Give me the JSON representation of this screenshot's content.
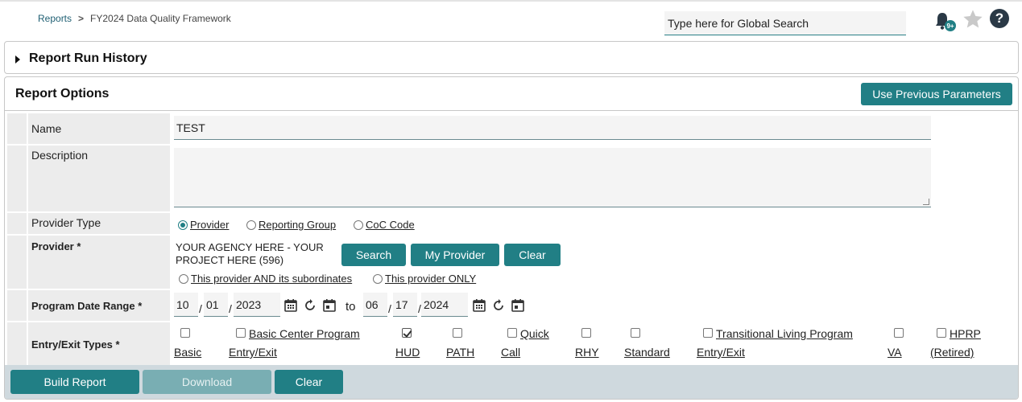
{
  "breadcrumb": {
    "root": "Reports",
    "separator": ">",
    "current": "FY2024 Data Quality Framework"
  },
  "global_search": {
    "placeholder": "Type here for Global Search"
  },
  "notifications": {
    "badge": "9+"
  },
  "help": {
    "glyph": "?"
  },
  "run_history": {
    "title": "Report Run History"
  },
  "options": {
    "title": "Report Options",
    "use_previous_label": "Use Previous Parameters",
    "name": {
      "label": "Name",
      "value": "TEST"
    },
    "description": {
      "label": "Description",
      "value": ""
    },
    "provider_type": {
      "label": "Provider Type",
      "options": [
        "Provider",
        "Reporting Group",
        "CoC Code"
      ],
      "selected": "Provider"
    },
    "provider": {
      "label": "Provider *",
      "value_line1": "YOUR AGENCY HERE - YOUR",
      "value_line2": "PROJECT HERE (596)",
      "search_label": "Search",
      "my_provider_label": "My Provider",
      "clear_label": "Clear",
      "scope_options": [
        "This provider AND its subordinates",
        "This provider ONLY"
      ]
    },
    "date_range": {
      "label": "Program Date Range *",
      "start": {
        "month": "10",
        "day": "01",
        "year": "2023"
      },
      "to": "to",
      "end": {
        "month": "06",
        "day": "17",
        "year": "2024"
      },
      "separator": "/"
    },
    "entry_exit": {
      "label": "Entry/Exit Types *",
      "types": [
        {
          "line1": "",
          "line2": "Basic",
          "checked": false
        },
        {
          "line1": "Basic Center Program",
          "line2": "Entry/Exit",
          "checked": false
        },
        {
          "line1": "",
          "line2": "HUD",
          "checked": true
        },
        {
          "line1": "",
          "line2": "PATH",
          "checked": false
        },
        {
          "line1": "Quick",
          "line2": "Call",
          "checked": false
        },
        {
          "line1": "",
          "line2": "RHY",
          "checked": false
        },
        {
          "line1": "",
          "line2": "Standard",
          "checked": false
        },
        {
          "line1": "Transitional Living Program",
          "line2": "Entry/Exit",
          "checked": false
        },
        {
          "line1": "",
          "line2": "VA",
          "checked": false
        },
        {
          "line1": "HPRP",
          "line2": "(Retired)",
          "checked": false
        }
      ]
    }
  },
  "footer": {
    "build_label": "Build Report",
    "download_label": "Download",
    "clear_label": "Clear"
  },
  "colors": {
    "accent": "#217f85",
    "disabled": "#79aeb3",
    "label_bg": "#ececec",
    "footer_bg": "#cfd9de"
  }
}
